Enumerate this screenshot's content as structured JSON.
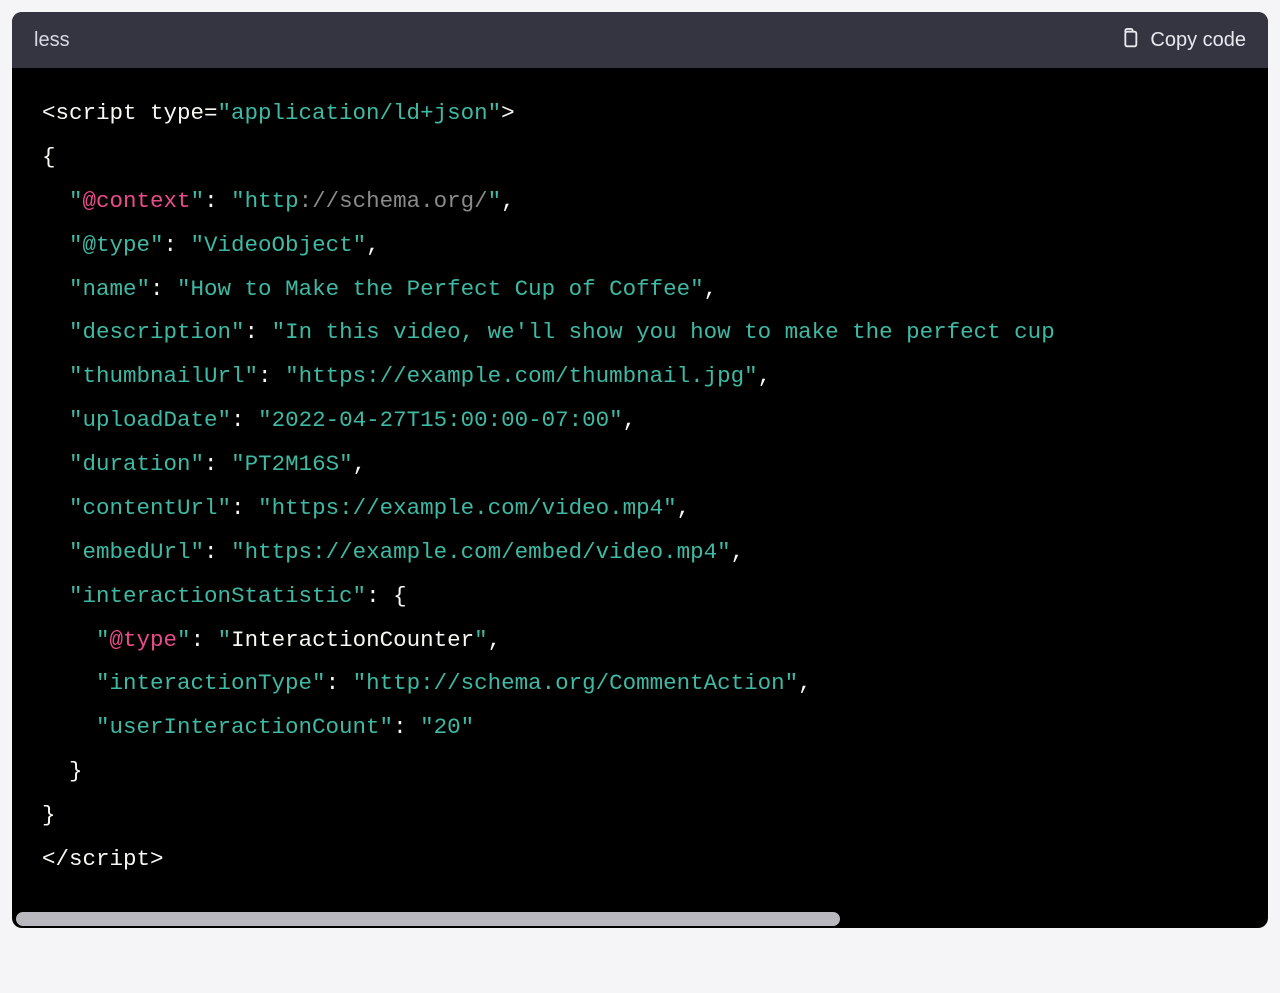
{
  "header": {
    "language": "less",
    "copy_label": "Copy code"
  },
  "colors": {
    "header_bg": "#343541",
    "code_bg": "#000000",
    "teal": "#3fb9a3",
    "pink": "#ea4b8b",
    "gray": "#8a8a8a",
    "white": "#f8f8f2"
  },
  "code": {
    "l1_a": "<script type=",
    "l1_b": "\"application/ld+json\"",
    "l1_c": ">",
    "l2": "{",
    "l3_q1": "\"",
    "l3_at": "@context",
    "l3_q2": "\"",
    "l3_colon": ": ",
    "l3_v1": "\"http",
    "l3_v2": "://schema.org/",
    "l3_v3": "\"",
    "l3_comma": ",",
    "l4_k": "\"@type\"",
    "l4_colon": ": ",
    "l4_v": "\"VideoObject\"",
    "l4_comma": ",",
    "l5_k": "\"name\"",
    "l5_colon": ": ",
    "l5_v": "\"How to Make the Perfect Cup of Coffee\"",
    "l5_comma": ",",
    "l6_k": "\"description\"",
    "l6_colon": ": ",
    "l6_v": "\"In this video, we'll show you how to make the perfect cup",
    "l7_k": "\"thumbnailUrl\"",
    "l7_colon": ": ",
    "l7_v": "\"https://example.com/thumbnail.jpg\"",
    "l7_comma": ",",
    "l8_k": "\"uploadDate\"",
    "l8_colon": ": ",
    "l8_v": "\"2022-04-27T15:00:00-07:00\"",
    "l8_comma": ",",
    "l9_k": "\"duration\"",
    "l9_colon": ": ",
    "l9_v": "\"PT2M16S\"",
    "l9_comma": ",",
    "l10_k": "\"contentUrl\"",
    "l10_colon": ": ",
    "l10_v": "\"https://example.com/video.mp4\"",
    "l10_comma": ",",
    "l11_k": "\"embedUrl\"",
    "l11_colon": ": ",
    "l11_v": "\"https://example.com/embed/video.mp4\"",
    "l11_comma": ",",
    "l12_k": "\"interactionStatistic\"",
    "l12_colon": ": ",
    "l12_brace": "{",
    "l13_q1": "\"",
    "l13_at": "@type",
    "l13_q2": "\"",
    "l13_colon": ": ",
    "l13_q3": "\"",
    "l13_v": "InteractionCounter",
    "l13_q4": "\"",
    "l13_comma": ",",
    "l14_k": "\"interactionType\"",
    "l14_colon": ": ",
    "l14_v": "\"http://schema.org/CommentAction\"",
    "l14_comma": ",",
    "l15_k": "\"userInteractionCount\"",
    "l15_colon": ": ",
    "l15_v": "\"20\"",
    "l16": "  }",
    "l17": "}",
    "l18": "</",
    "l18b": "script",
    "l18c": ">"
  }
}
